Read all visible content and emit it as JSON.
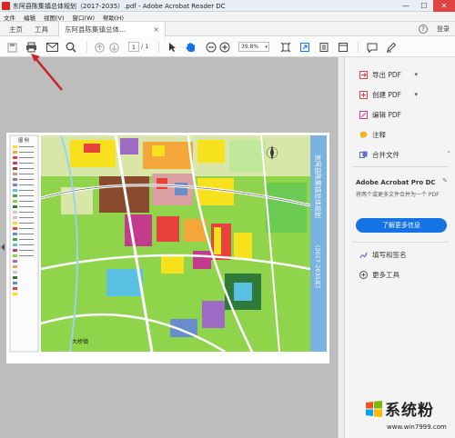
{
  "window": {
    "title": "东阿县陈集镇总体规划（2017-2035）.pdf - Adobe Acrobat Reader DC",
    "min": "—",
    "max": "☐",
    "close": "✕"
  },
  "menubar": {
    "items": [
      "文件",
      "编辑",
      "视图(V)",
      "窗口(W)",
      "帮助(H)"
    ]
  },
  "tabs": {
    "home": "主页",
    "tools": "工具",
    "doc": "东阿县陈集镇总体...",
    "close": "×",
    "help": "?",
    "signin": "登录"
  },
  "toolbar": {
    "page_current": "1",
    "page_total": "/ 1",
    "zoom": "39.8%",
    "zoom_arrow": "▾"
  },
  "map_document": {
    "vertical_title_1": "东阿县陈集镇总体规划",
    "vertical_title_2": "（2017-2035年）",
    "legend_heading": "图 例",
    "place_label": "大桥镇"
  },
  "right_panel": {
    "export_pdf": "导出 PDF",
    "create_pdf": "创建 PDF",
    "edit_pdf": "编辑 PDF",
    "comment": "注释",
    "combine": "合并文件",
    "promo_title": "Adobe Acrobat Pro DC",
    "promo_desc": "将两个或更多文件合并为一个 PDF",
    "promo_button": "了解更多信息",
    "fill_sign": "填写和签名",
    "more_tools": "更多工具"
  },
  "watermark": {
    "brand": "系统粉",
    "url": "www.win7999.com"
  },
  "colors": {
    "accent": "#1473e6",
    "export": "#e0443e",
    "create": "#e0443e",
    "edit": "#d8398c",
    "comment": "#f3b21c",
    "combine": "#5a6fd0",
    "fill_sign": "#7a5cd6",
    "annotation_arrow": "#c8232a"
  }
}
